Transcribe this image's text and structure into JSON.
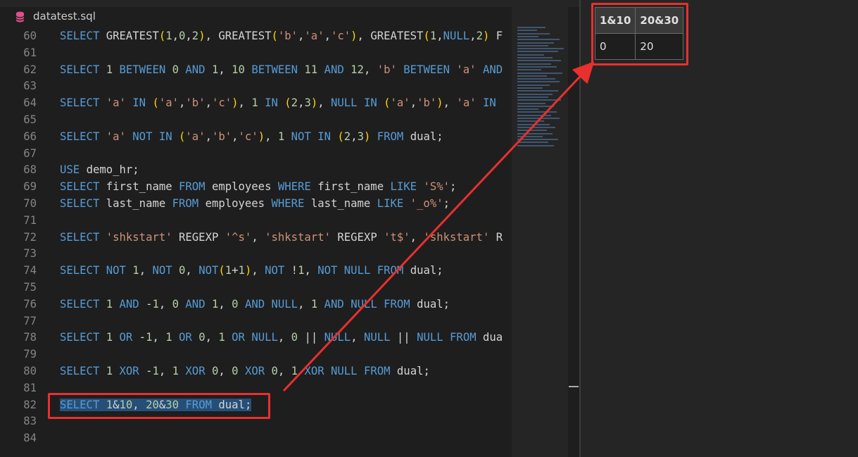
{
  "tab": {
    "filename": "datatest.sql",
    "icon": "database-icon"
  },
  "editor": {
    "lines": [
      {
        "n": "60",
        "text": "SELECT GREATEST(1,0,2), GREATEST('b','a','c'), GREATEST(1,NULL,2) F"
      },
      {
        "n": "61",
        "text": ""
      },
      {
        "n": "62",
        "text": "SELECT 1 BETWEEN 0 AND 1, 10 BETWEEN 11 AND 12, 'b' BETWEEN 'a' AND"
      },
      {
        "n": "63",
        "text": ""
      },
      {
        "n": "64",
        "text": "SELECT 'a' IN ('a','b','c'), 1 IN (2,3), NULL IN ('a','b'), 'a' IN"
      },
      {
        "n": "65",
        "text": ""
      },
      {
        "n": "66",
        "text": "SELECT 'a' NOT IN ('a','b','c'), 1 NOT IN (2,3) FROM dual;"
      },
      {
        "n": "67",
        "text": ""
      },
      {
        "n": "68",
        "text": "USE demo_hr;"
      },
      {
        "n": "69",
        "text": "SELECT first_name FROM employees WHERE first_name LIKE 'S%';"
      },
      {
        "n": "70",
        "text": "SELECT last_name FROM employees WHERE last_name LIKE '_o%';"
      },
      {
        "n": "71",
        "text": ""
      },
      {
        "n": "72",
        "text": "SELECT 'shkstart' REGEXP '^s', 'shkstart' REGEXP 't$', 'shkstart' R"
      },
      {
        "n": "73",
        "text": ""
      },
      {
        "n": "74",
        "text": "SELECT NOT 1, NOT 0, NOT(1+1), NOT !1, NOT NULL FROM dual;"
      },
      {
        "n": "75",
        "text": ""
      },
      {
        "n": "76",
        "text": "SELECT 1 AND -1, 0 AND 1, 0 AND NULL, 1 AND NULL FROM dual;"
      },
      {
        "n": "77",
        "text": ""
      },
      {
        "n": "78",
        "text": "SELECT 1 OR -1, 1 OR 0, 1 OR NULL, 0 || NULL, NULL || NULL FROM dua"
      },
      {
        "n": "79",
        "text": ""
      },
      {
        "n": "80",
        "text": "SELECT 1 XOR -1, 1 XOR 0, 0 XOR 0, 1 XOR NULL FROM dual;"
      },
      {
        "n": "81",
        "text": ""
      },
      {
        "n": "82",
        "text": "SELECT 1&10, 20&30 FROM dual;"
      },
      {
        "n": "83",
        "text": ""
      },
      {
        "n": "84",
        "text": ""
      }
    ],
    "selected_line": "82"
  },
  "results": {
    "columns": [
      "1&10",
      "20&30"
    ],
    "rows": [
      [
        "0",
        "20"
      ]
    ]
  },
  "colors": {
    "highlight": "#e8302e",
    "keyword": "#569cd6",
    "string": "#ce9178",
    "number": "#b5cea8",
    "bracket": "#ffd700",
    "selection": "#264f78"
  }
}
